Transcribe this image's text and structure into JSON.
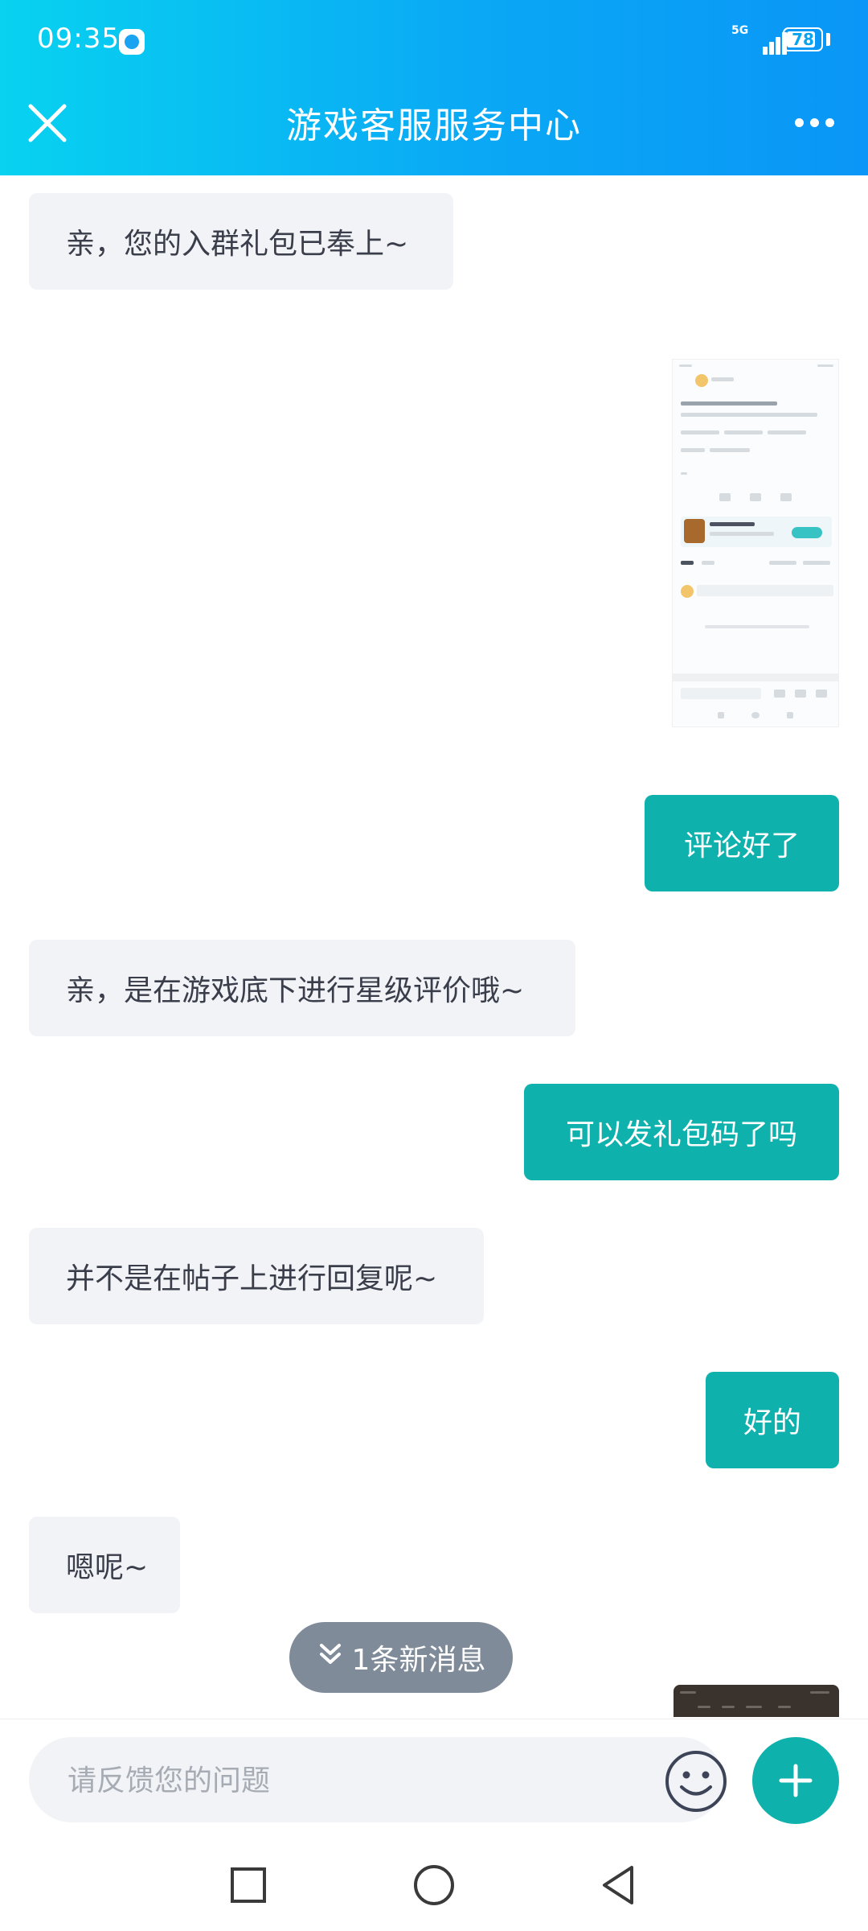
{
  "status_bar": {
    "time": "09:35",
    "network": "5G",
    "battery": "78"
  },
  "header": {
    "title": "游戏客服服务中心"
  },
  "messages": [
    {
      "side": "in",
      "text": "亲，您的入群礼包已奉上~"
    },
    {
      "side": "out",
      "type": "image"
    },
    {
      "side": "out",
      "text": "评论好了"
    },
    {
      "side": "in",
      "text": "亲，是在游戏底下进行星级评价哦~"
    },
    {
      "side": "out",
      "text": "可以发礼包码了吗"
    },
    {
      "side": "in",
      "text": "并不是在帖子上进行回复呢~"
    },
    {
      "side": "out",
      "text": "好的"
    },
    {
      "side": "in",
      "text": "嗯呢~"
    },
    {
      "side": "out",
      "type": "image"
    }
  ],
  "new_message_tip": "1条新消息",
  "input": {
    "placeholder": "请反馈您的问题",
    "value": ""
  },
  "colors": {
    "header_gradient_start": "#08d2f0",
    "header_gradient_end": "#0a96f6",
    "outgoing_bubble": "#0fb1ad",
    "incoming_bubble": "#f1f3f7",
    "new_msg_pill": "#7f8b99"
  },
  "icons": {
    "close": "close-icon",
    "more": "more-dots-icon",
    "emoji": "smiley-icon",
    "plus": "plus-icon",
    "new_messages": "double-chevron-down-icon",
    "nav_recent": "square-icon",
    "nav_home": "circle-icon",
    "nav_back": "triangle-back-icon"
  }
}
